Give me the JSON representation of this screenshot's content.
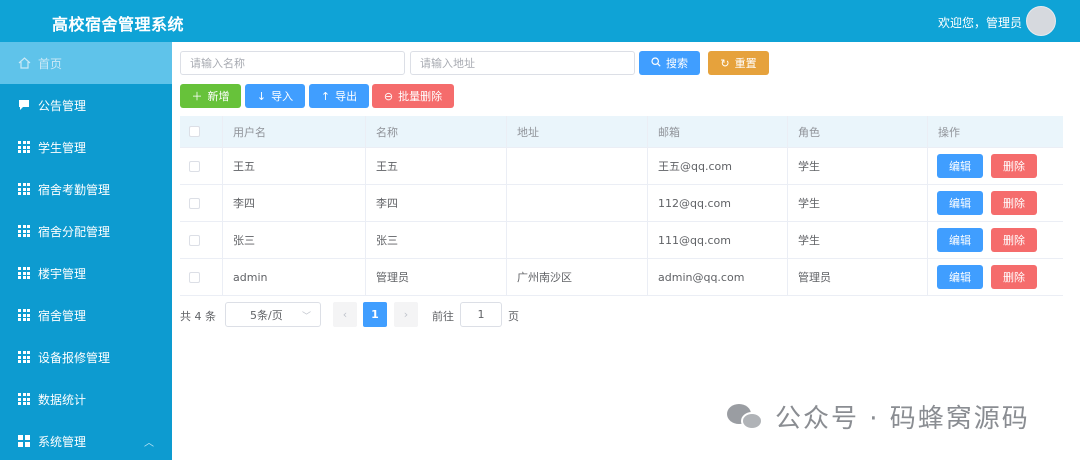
{
  "header": {
    "title": "高校宿舍管理系统",
    "welcome": "欢迎您，管理员"
  },
  "sidebar": {
    "items": [
      {
        "label": "首页",
        "icon": "home-icon"
      },
      {
        "label": "公告管理",
        "icon": "message-icon"
      },
      {
        "label": "学生管理",
        "icon": "grid-icon"
      },
      {
        "label": "宿舍考勤管理",
        "icon": "grid-icon"
      },
      {
        "label": "宿舍分配管理",
        "icon": "grid-icon"
      },
      {
        "label": "楼宇管理",
        "icon": "grid-icon"
      },
      {
        "label": "宿舍管理",
        "icon": "grid-icon"
      },
      {
        "label": "设备报修管理",
        "icon": "grid-icon"
      },
      {
        "label": "数据统计",
        "icon": "grid-icon"
      },
      {
        "label": "系统管理",
        "icon": "menu-icon"
      }
    ]
  },
  "search": {
    "name_placeholder": "请输入名称",
    "address_placeholder": "请输入地址",
    "search_label": "搜索",
    "reset_label": "重置"
  },
  "toolbar": {
    "add_label": "新增",
    "import_label": "导入",
    "export_label": "导出",
    "batch_delete_label": "批量删除"
  },
  "table": {
    "columns": [
      "用户名",
      "名称",
      "地址",
      "邮箱",
      "角色",
      "操作"
    ],
    "rows": [
      {
        "username": "王五",
        "name": "王五",
        "address": "",
        "email": "王五@qq.com",
        "role": "学生"
      },
      {
        "username": "李四",
        "name": "李四",
        "address": "",
        "email": "112@qq.com",
        "role": "学生"
      },
      {
        "username": "张三",
        "name": "张三",
        "address": "",
        "email": "111@qq.com",
        "role": "学生"
      },
      {
        "username": "admin",
        "name": "管理员",
        "address": "广州南沙区",
        "email": "admin@qq.com",
        "role": "管理员"
      }
    ],
    "edit_label": "编辑",
    "delete_label": "删除"
  },
  "pagination": {
    "total_text": "共 4 条",
    "page_size": "5条/页",
    "current_page": "1",
    "goto_label": "前往",
    "goto_value": "1",
    "page_suffix": "页"
  },
  "watermark": {
    "text": "公众号 · 码蜂窝源码"
  },
  "colors": {
    "header": "#0fa3d6",
    "sidebar": "#0d9bd0",
    "primary": "#409eff",
    "success": "#67c23a",
    "warning": "#e6a23c",
    "danger": "#f56c6c"
  }
}
